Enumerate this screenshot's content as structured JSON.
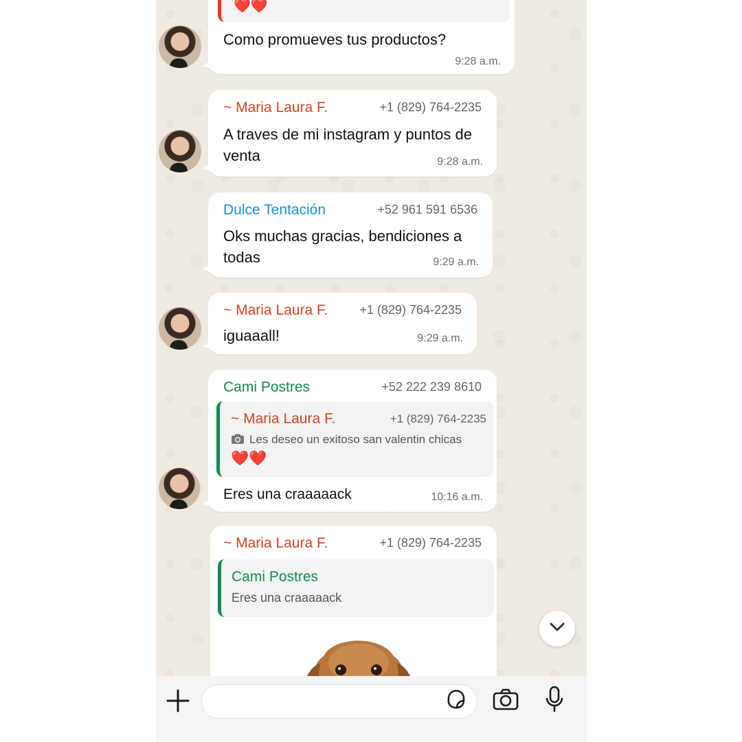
{
  "messages": {
    "m0": {
      "emoji": "❤️❤️",
      "text": "Como promueves tus productos?",
      "time": "9:28 a.m."
    },
    "m1": {
      "sender": "~ Maria Laura F.",
      "phone": "+1 (829) 764-2235",
      "text": "A traves de mi instagram y puntos de venta",
      "time": "9:28 a.m."
    },
    "m2": {
      "sender": "Dulce Tentación",
      "phone": "+52 961 591 6536",
      "text": "Oks muchas gracias, bendiciones a todas",
      "time": "9:29 a.m."
    },
    "m3": {
      "sender": "~ Maria Laura F.",
      "phone": "+1 (829) 764-2235",
      "text": "iguaaall!",
      "time": "9:29 a.m."
    },
    "m4": {
      "sender": "Cami Postres",
      "phone": "+52 222 239 8610",
      "quote": {
        "sender": "~ Maria Laura F.",
        "phone": "+1 (829) 764-2235",
        "text": "Les deseo un exitoso san valentin chicas",
        "emoji": "❤️❤️"
      },
      "text": "Eres una craaaaack",
      "time": "10:16 a.m."
    },
    "m5": {
      "sender": "~ Maria Laura F.",
      "phone": "+1 (829) 764-2235",
      "quote": {
        "sender": "Cami Postres",
        "text": "Eres una craaaaack"
      }
    }
  },
  "colors": {
    "chat_bg": "#efeae2",
    "orange_name": "#d2451e",
    "blue_name": "#1a8fd8",
    "green_name": "#128c4e"
  },
  "icons": {
    "scroll": "chevron-down-icon",
    "attach": "plus-icon",
    "sticker": "sticker-icon",
    "camera": "camera-icon",
    "mic": "mic-icon",
    "quote_photo": "camera-small-icon"
  }
}
